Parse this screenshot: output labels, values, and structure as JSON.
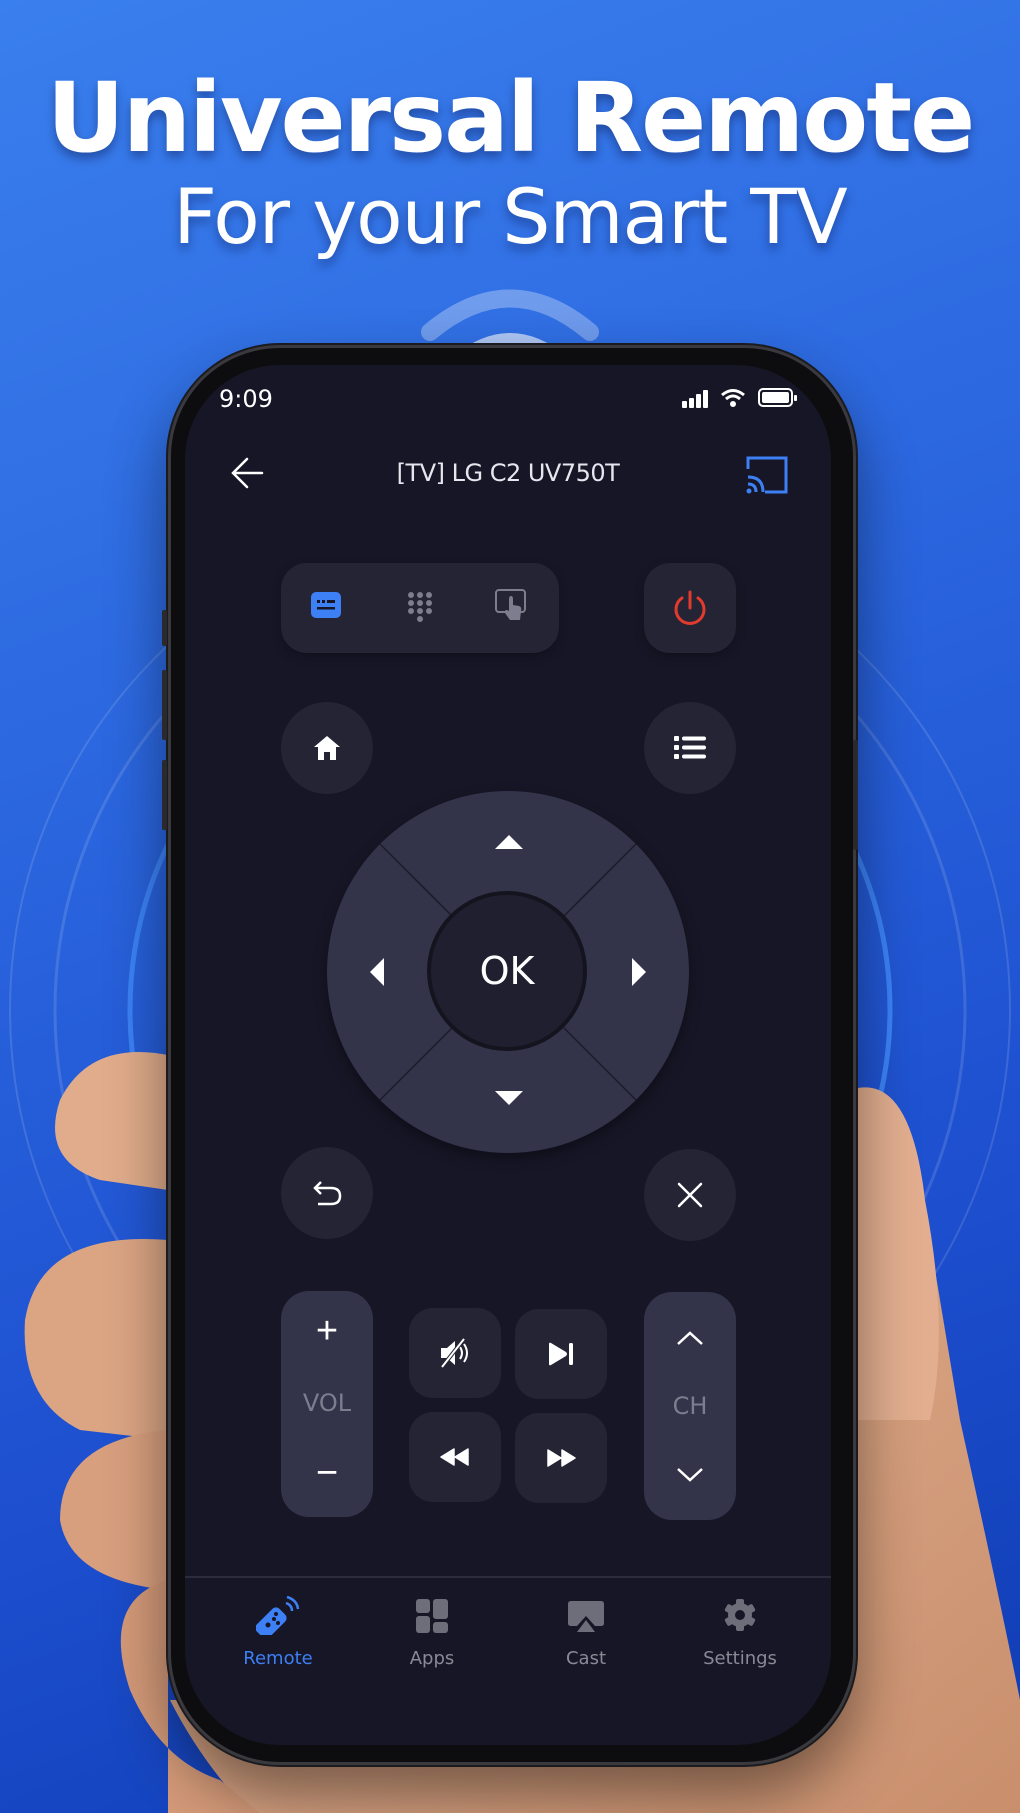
{
  "promo": {
    "headline": "Universal Remote",
    "subheadline": "For your Smart TV"
  },
  "colors": {
    "accent": "#3d7ff5",
    "power": "#e23b2e",
    "screen_bg": "#161626",
    "button_bg": "#242434",
    "dpad_bg": "#33344a",
    "inactive": "#8a8a96"
  },
  "status_bar": {
    "time": "9:09",
    "icons": [
      "signal-icon",
      "wifi-icon",
      "battery-icon"
    ]
  },
  "header": {
    "back_icon": "arrow-left-icon",
    "device_title": "[TV] LG C2  UV750T",
    "cast_icon": "screen-cast-icon"
  },
  "mode_selector": {
    "modes": [
      {
        "name": "keyboard",
        "icon": "keyboard-icon",
        "active": true
      },
      {
        "name": "numpad",
        "icon": "numpad-icon",
        "active": false
      },
      {
        "name": "touchpad",
        "icon": "touchpad-icon",
        "active": false
      }
    ]
  },
  "buttons": {
    "power": "power-icon",
    "home": "home-icon",
    "menu": "list-icon",
    "ok_label": "OK",
    "back": "return-icon",
    "exit": "close-icon"
  },
  "volume": {
    "label": "VOL",
    "plus": "+",
    "minus": "−"
  },
  "channel": {
    "label": "CH"
  },
  "media": [
    "mute-icon",
    "play-next-icon",
    "rewind-icon",
    "fast-forward-icon"
  ],
  "tab_bar": {
    "tabs": [
      {
        "label": "Remote",
        "icon": "remote-icon",
        "active": true
      },
      {
        "label": "Apps",
        "icon": "apps-grid-icon",
        "active": false
      },
      {
        "label": "Cast",
        "icon": "airplay-icon",
        "active": false
      },
      {
        "label": "Settings",
        "icon": "gear-icon",
        "active": false
      }
    ]
  }
}
